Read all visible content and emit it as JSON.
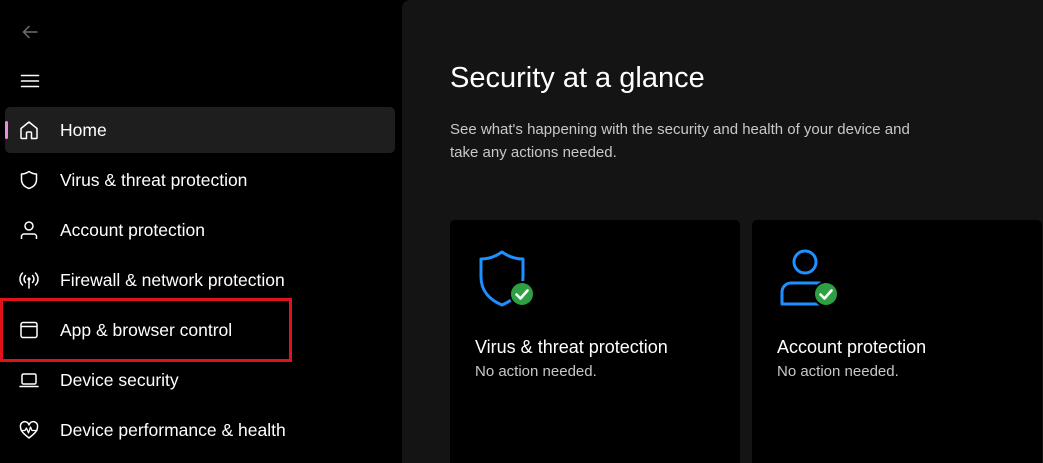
{
  "sidebar": {
    "items": [
      {
        "label": "Home",
        "icon": "home-icon",
        "active": true
      },
      {
        "label": "Virus & threat protection",
        "icon": "shield-icon",
        "active": false
      },
      {
        "label": "Account protection",
        "icon": "person-icon",
        "active": false
      },
      {
        "label": "Firewall & network protection",
        "icon": "wifi-antenna-icon",
        "active": false
      },
      {
        "label": "App & browser control",
        "icon": "app-window-icon",
        "active": false
      },
      {
        "label": "Device security",
        "icon": "laptop-icon",
        "active": false
      },
      {
        "label": "Device performance & health",
        "icon": "heart-pulse-icon",
        "active": false
      }
    ],
    "highlighted_item": "App & browser control"
  },
  "main": {
    "title": "Security at a glance",
    "subtitle": "See what's happening with the security and health of your device and take any actions needed.",
    "cards": [
      {
        "title": "Virus & threat protection",
        "status": "No action needed.",
        "icon": "shield-check-icon"
      },
      {
        "title": "Account protection",
        "status": "No action needed.",
        "icon": "person-check-icon"
      }
    ]
  },
  "colors": {
    "accent_indicator": "#e58ee0",
    "highlight_border": "#e0131b",
    "icon_blue": "#1e90ff",
    "check_green": "#2ea043",
    "main_bg": "#141414",
    "sidebar_bg": "#000000",
    "active_item_bg": "#1e1e1e"
  }
}
